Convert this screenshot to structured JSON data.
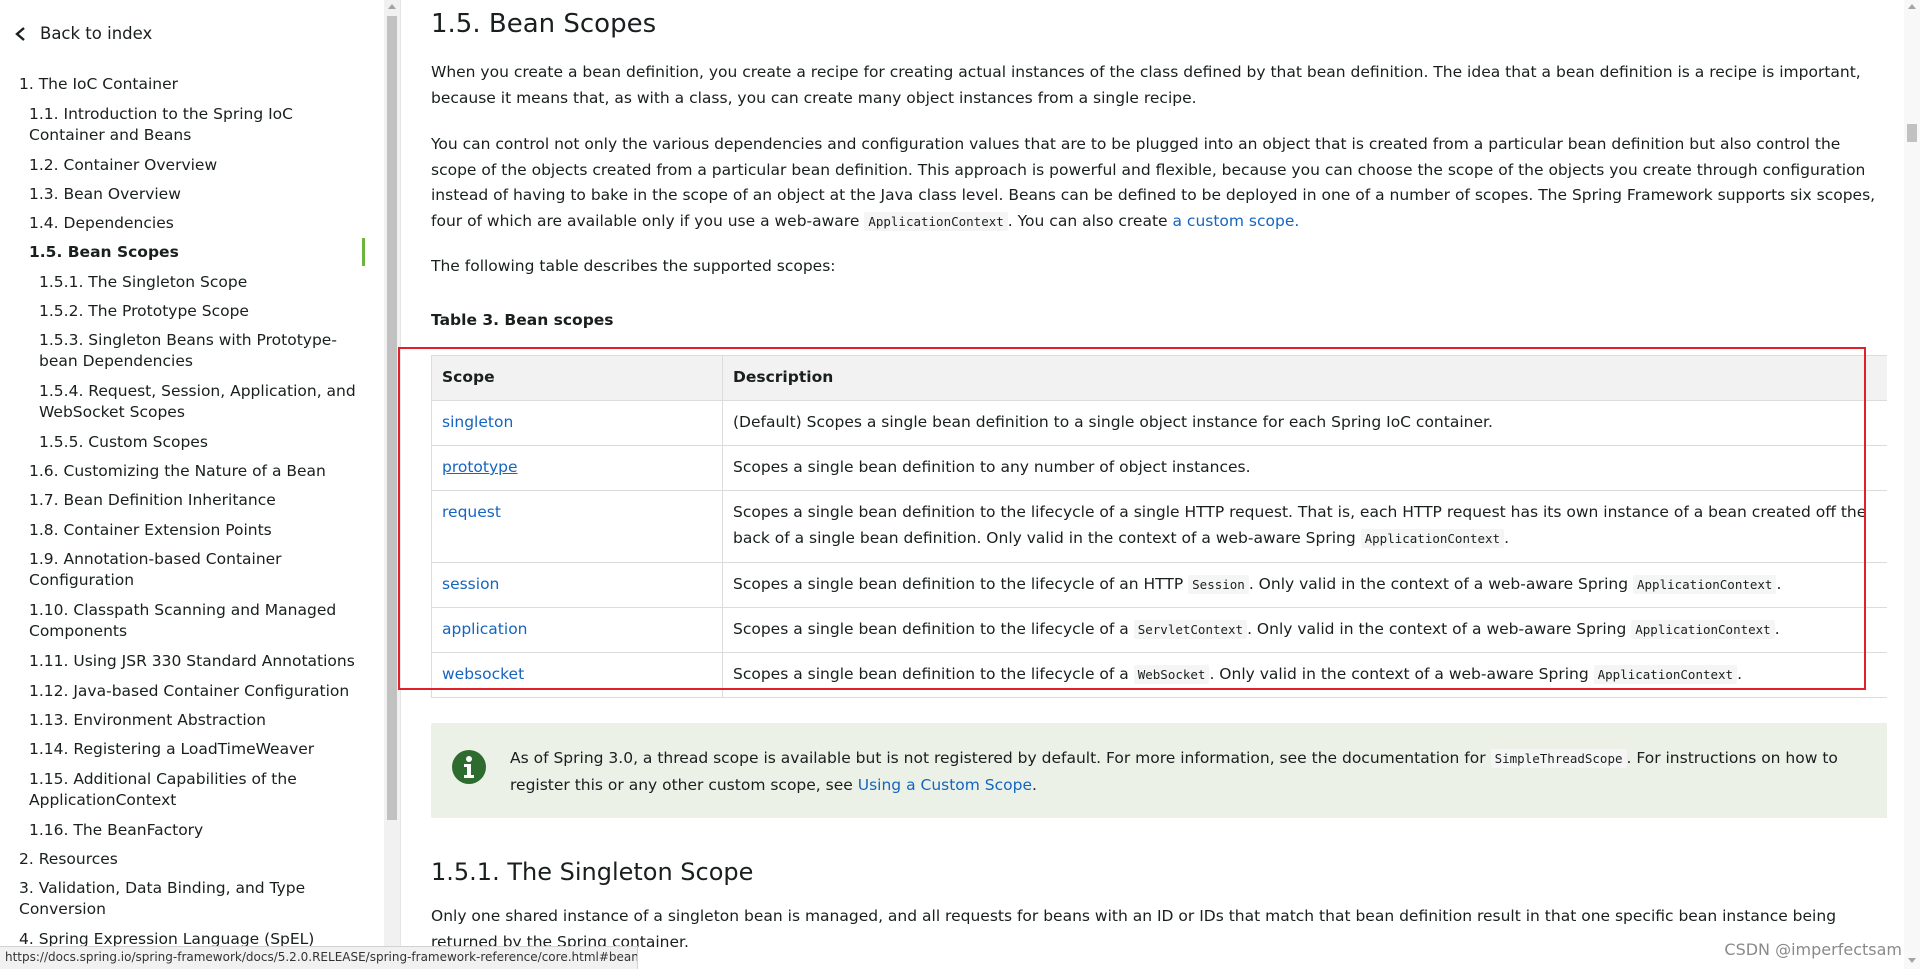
{
  "sidebar": {
    "back_label": "Back to index",
    "items": [
      {
        "label": "1. The IoC Container"
      },
      {
        "label": "1.1. Introduction to the Spring IoC Container and Beans"
      },
      {
        "label": "1.2. Container Overview"
      },
      {
        "label": "1.3. Bean Overview"
      },
      {
        "label": "1.4. Dependencies"
      },
      {
        "label": "1.5. Bean Scopes",
        "active": true
      },
      {
        "label": "1.5.1. The Singleton Scope"
      },
      {
        "label": "1.5.2. The Prototype Scope"
      },
      {
        "label": "1.5.3. Singleton Beans with Prototype-bean Dependencies"
      },
      {
        "label": "1.5.4. Request, Session, Application, and WebSocket Scopes"
      },
      {
        "label": "1.5.5. Custom Scopes"
      },
      {
        "label": "1.6. Customizing the Nature of a Bean"
      },
      {
        "label": "1.7. Bean Definition Inheritance"
      },
      {
        "label": "1.8. Container Extension Points"
      },
      {
        "label": "1.9. Annotation-based Container Configuration"
      },
      {
        "label": "1.10. Classpath Scanning and Managed Components"
      },
      {
        "label": "1.11. Using JSR 330 Standard Annotations"
      },
      {
        "label": "1.12. Java-based Container Configuration"
      },
      {
        "label": "1.13. Environment Abstraction"
      },
      {
        "label": "1.14. Registering a LoadTimeWeaver"
      },
      {
        "label": "1.15. Additional Capabilities of the ApplicationContext"
      },
      {
        "label": "1.16. The BeanFactory"
      },
      {
        "label": "2. Resources"
      },
      {
        "label": "3. Validation, Data Binding, and Type Conversion"
      },
      {
        "label": "4. Spring Expression Language (SpEL)"
      }
    ]
  },
  "main": {
    "title": "1.5. Bean Scopes",
    "intro_p1": "When you create a bean definition, you create a recipe for creating actual instances of the class defined by that bean definition. The idea that a bean definition is a recipe is important, because it means that, as with a class, you can create many object instances from a single recipe.",
    "intro_p2_before": "You can control not only the various dependencies and configuration values that are to be plugged into an object that is created from a particular bean definition but also control the scope of the objects created from a particular bean definition. This approach is powerful and flexible, because you can choose the scope of the objects you create through configuration instead of having to bake in the scope of an object at the Java class level. Beans can be defined to be deployed in one of a number of scopes. The Spring Framework supports six scopes, four of which are available only if you use a web-aware",
    "intro_p2_code": "ApplicationContext",
    "intro_p2_mid": ". You can also create",
    "intro_p2_link": "a custom scope.",
    "intro_p3": "The following table describes the supported scopes:",
    "table_caption": "Table 3. Bean scopes",
    "table": {
      "headers": [
        "Scope",
        "Description"
      ],
      "rows": [
        {
          "scope": "singleton",
          "desc": "(Default) Scopes a single bean definition to a single object instance for each Spring IoC container."
        },
        {
          "scope": "prototype",
          "desc": "Scopes a single bean definition to any number of object instances."
        },
        {
          "scope": "request",
          "desc_before": "Scopes a single bean definition to the lifecycle of a single HTTP request. That is, each HTTP request has its own instance of a bean created off the back of a single bean definition. Only valid in the context of a web-aware Spring",
          "code": "ApplicationContext",
          "desc_after": "."
        },
        {
          "scope": "session",
          "desc_before": "Scopes a single bean definition to the lifecycle of an HTTP",
          "code1": "Session",
          "desc_mid": ". Only valid in the context of a web-aware Spring",
          "code2": "ApplicationContext",
          "desc_after": "."
        },
        {
          "scope": "application",
          "desc_before": "Scopes a single bean definition to the lifecycle of a",
          "code1": "ServletContext",
          "desc_mid": ". Only valid in the context of a web-aware Spring",
          "code2": "ApplicationContext",
          "desc_after": "."
        },
        {
          "scope": "websocket",
          "desc_before": "Scopes a single bean definition to the lifecycle of a",
          "code1": "WebSocket",
          "desc_mid": ". Only valid in the context of a web-aware Spring",
          "code2": "ApplicationContext",
          "desc_after": "."
        }
      ]
    },
    "note": {
      "icon": "info-icon",
      "text_before": "As of Spring 3.0, a thread scope is available but is not registered by default. For more information, see the documentation for",
      "code": "SimpleThreadScope",
      "text_mid": ". For instructions on how to register this or any other custom scope, see",
      "link": "Using a Custom Scope",
      "text_after": "."
    },
    "subtitle": "1.5.1. The Singleton Scope",
    "singleton_p": "Only one shared instance of a singleton bean is managed, and all requests for beans with an ID or IDs that match that bean definition result in that one specific bean instance being returned by the Spring container."
  },
  "status_url": "https://docs.spring.io/spring-framework/docs/5.2.0.RELEASE/spring-framework-reference/core.html#beans...",
  "watermark": "CSDN @imperfectsam",
  "colors": {
    "link": "#1565c0",
    "accent_green": "#6db33f",
    "highlight_red": "#e0202a",
    "note_bg": "#ebf1e7"
  }
}
